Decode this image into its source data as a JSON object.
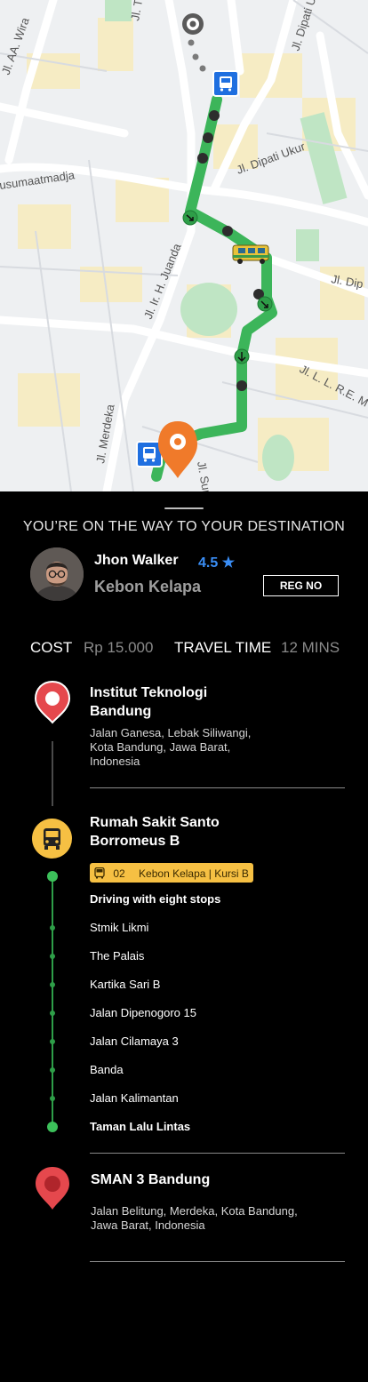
{
  "map": {
    "street_labels": [
      "Jl. Ir. H. Juanda",
      "Jl. Dipati Ukur",
      "Jl. Dipati Ukur",
      "Jl. Merdeka",
      "Jl. L. L. R.E. M",
      "Jl. Dip",
      "usumaatmadja",
      "Jl. T",
      "Jl. AA. Wira",
      "Jl. Sum"
    ],
    "route_color": "#3cb55a"
  },
  "sheet": {
    "headline": "YOU’RE ON THE WAY TO YOUR DESTINATION",
    "driver": {
      "name": "Jhon Walker",
      "rating": "4.5 ★",
      "vehicle_route": "Kebon Kelapa",
      "reg_button": "REG NO"
    },
    "trip": {
      "cost_label": "COST",
      "cost_value": "Rp 15.000",
      "time_label": "TRAVEL TIME",
      "time_value": "12 MINS"
    },
    "origin": {
      "title_line1": "Institut Teknologi",
      "title_line2": "Bandung",
      "address_line1": "Jalan Ganesa, Lebak Siliwangi,",
      "address_line2": "Kota Bandung, Jawa Barat,",
      "address_line3": "Indonesia"
    },
    "boarding": {
      "title_line1": "Rumah Sakit Santo",
      "title_line2": "Borromeus B",
      "badge_route_no": "02",
      "badge_text": "Kebon Kelapa | Kursi B",
      "driving_note": "Driving with eight stops",
      "stops": [
        "Stmik Likmi",
        "The Palais",
        "Kartika Sari B",
        "Jalan Dipenogoro 15",
        "Jalan Cilamaya 3",
        "Banda",
        "Jalan Kalimantan",
        "Taman Lalu Lintas"
      ]
    },
    "destination": {
      "title": "SMAN 3 Bandung",
      "address_line1": "Jalan Belitung, Merdeka, Kota Bandung,",
      "address_line2": "Jawa Barat, Indonesia"
    }
  },
  "colors": {
    "accent_blue": "#3a8ef6",
    "badge_yellow": "#f6c043",
    "route_green": "#2e9e48",
    "pin_red": "#e5484d",
    "pin_orange": "#f07a2a"
  }
}
